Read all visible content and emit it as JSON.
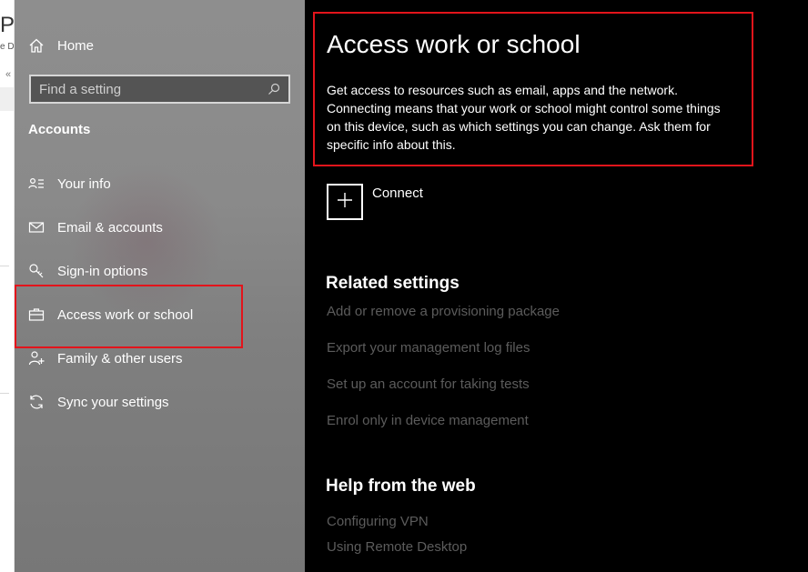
{
  "background_window": {
    "title_fragment": "P",
    "subtitle_fragment": "e D",
    "chevron": "«"
  },
  "sidebar": {
    "home_label": "Home",
    "search_placeholder": "Find a setting",
    "section_title": "Accounts",
    "items": [
      {
        "label": "Your info",
        "icon": "person-list-icon"
      },
      {
        "label": "Email & accounts",
        "icon": "mail-icon"
      },
      {
        "label": "Sign-in options",
        "icon": "key-icon"
      },
      {
        "label": "Access work or school",
        "icon": "briefcase-icon",
        "selected": true
      },
      {
        "label": "Family & other users",
        "icon": "person-add-icon"
      },
      {
        "label": "Sync your settings",
        "icon": "sync-icon"
      }
    ]
  },
  "main": {
    "title": "Access work or school",
    "description": "Get access to resources such as email, apps and the network. Connecting means that your work or school might control some things on this device, such as which settings you can change. Ask them for specific info about this.",
    "connect_label": "Connect",
    "related_settings": {
      "title": "Related settings",
      "links": [
        "Add or remove a provisioning package",
        "Export your management log files",
        "Set up an account for taking tests",
        "Enrol only in device management"
      ]
    },
    "help": {
      "title": "Help from the web",
      "links": [
        "Configuring VPN",
        "Using Remote Desktop"
      ]
    }
  },
  "colors": {
    "highlight_border": "#e3141b",
    "main_background": "#000000",
    "sidebar_background": "#888888",
    "link_disabled": "#5c5c5c"
  }
}
